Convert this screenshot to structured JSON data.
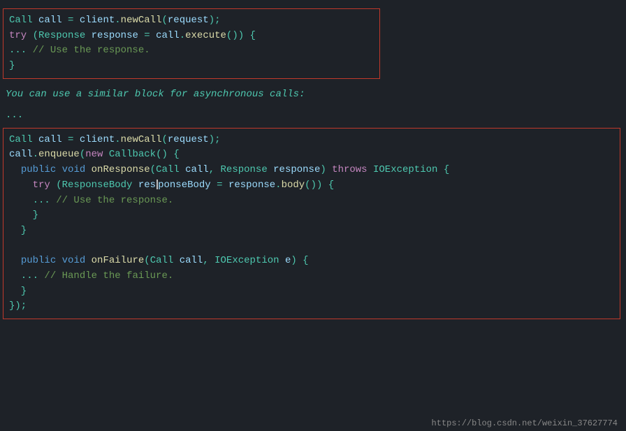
{
  "page": {
    "background": "#1e2228",
    "watermark": "https://blog.csdn.net/weixin_37627774"
  },
  "top_block": {
    "lines": [
      "Call call = client.newCall(request);",
      "try (Response response = call.execute()) {",
      "... // Use the response.",
      "}"
    ]
  },
  "prose": {
    "text": "You can use a similar block for asynchronous calls:"
  },
  "ellipsis": "...",
  "bottom_block": {
    "lines": [
      "Call call = client.newCall(request);",
      "call.enqueue(new Callback() {",
      "  public void onResponse(Call call, Response response) throws IOException {",
      "    try (ResponseBody responseBody = response.body()) {",
      "    ... // Use the response.",
      "    }",
      "  }",
      "",
      "  public void onFailure(Call call, IOException e) {",
      "  ... // Handle the failure.",
      "  }",
      "});"
    ]
  }
}
